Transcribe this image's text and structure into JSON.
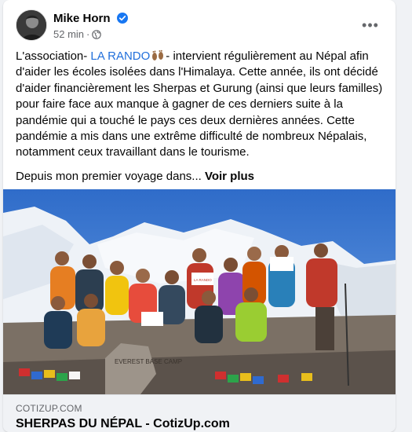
{
  "post": {
    "author": "Mike Horn",
    "time": "52 min",
    "separator": "·",
    "more_options": "•••",
    "text": {
      "pre_link": "L'association- ",
      "link": "LA RANDO",
      "post_link": "- intervient régulièrement au Népal afin d'aider les écoles isolées dans l'Himalaya. Cette année, ils ont décidé d'aider financièrement les Sherpas et Gurung (ainsi que leurs familles) pour faire face aux manque à gagner de ces derniers suite à la pandémie qui a touché le pays ces deux dernières années. Cette pandémie a mis dans une extrême difficulté de nombreux Népalais, notamment ceux travaillant dans le tourisme.",
      "para2": "Depuis mon premier voyage dans... ",
      "see_more": "Voir plus"
    },
    "photo": {
      "sign_text": "EVEREST BASE CAMP",
      "banner_text": "LA RANDO"
    },
    "link_preview": {
      "domain": "COTIZUP.COM",
      "title": "SHERPAS DU NÉPAL - CotizUp.com"
    }
  },
  "colors": {
    "link": "#216fdb",
    "verified": "#1877f2",
    "secondary_text": "#65676b",
    "sky": "#3f7fd6"
  },
  "icons": [
    "verified-badge-icon",
    "globe-icon",
    "footprints-emoji-icon",
    "more-options-icon"
  ]
}
